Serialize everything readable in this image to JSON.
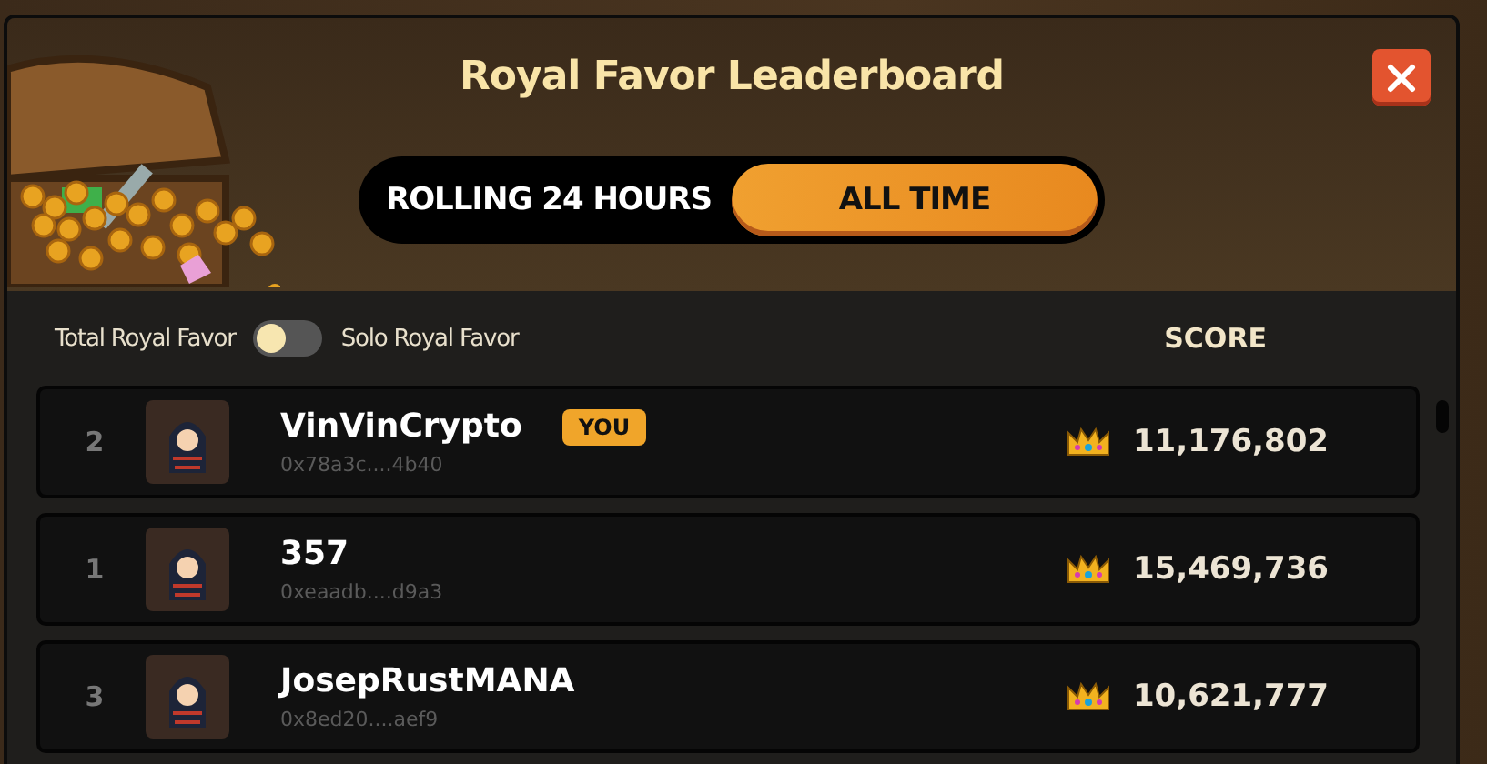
{
  "title": "Royal Favor Leaderboard",
  "tabs": [
    {
      "label": "ROLLING 24 HOURS",
      "selected": false
    },
    {
      "label": "ALL TIME",
      "selected": true
    }
  ],
  "filter": {
    "left_label": "Total Royal Favor",
    "on": false,
    "right_label": "Solo Royal Favor"
  },
  "score_header": "SCORE",
  "rows": [
    {
      "rank": "2",
      "name": "VinVinCrypto",
      "badge": "YOU",
      "address": "0x78a3c....4b40",
      "score": "11,176,802"
    },
    {
      "rank": "1",
      "name": "357",
      "address": "0xeaadb....d9a3",
      "score": "15,469,736"
    },
    {
      "rank": "3",
      "name": "JosepRustMANA",
      "address": "0x8ed20....aef9",
      "score": "10,621,777"
    }
  ]
}
